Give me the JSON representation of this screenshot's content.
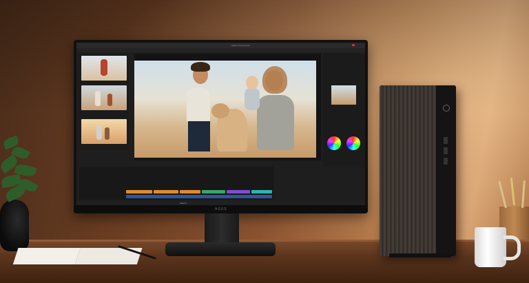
{
  "scene": {
    "monitor_logo": "ASUS"
  },
  "screen": {
    "app_title": "Adobe Premiere Pro",
    "taskbar_search": "Search"
  },
  "colors": {
    "wall": "#8a5230",
    "desk": "#5b341c",
    "monitor": "#111111",
    "track_orange": "#e08a2e",
    "track_green": "#3aa56a",
    "track_blue": "#3b6fd0",
    "track_purple": "#7b4fd0",
    "track_teal": "#2fb3b0"
  }
}
